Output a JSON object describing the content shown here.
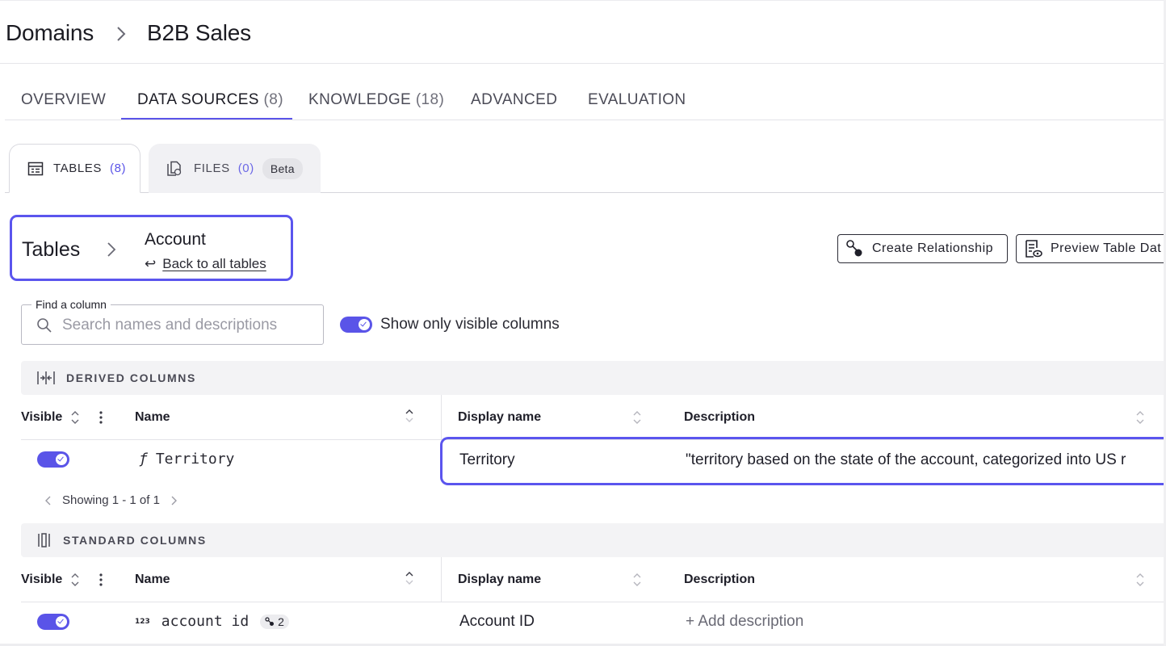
{
  "breadcrumb": {
    "root": "Domains",
    "current": "B2B Sales"
  },
  "main_tabs": [
    {
      "label": "OVERVIEW",
      "count": ""
    },
    {
      "label": "DATA SOURCES",
      "count": "(8)"
    },
    {
      "label": "KNOWLEDGE",
      "count": "(18)"
    },
    {
      "label": "ADVANCED",
      "count": ""
    },
    {
      "label": "EVALUATION",
      "count": ""
    }
  ],
  "sub_tabs": {
    "tables": {
      "label": "TABLES",
      "count": "(8)"
    },
    "files": {
      "label": "FILES",
      "count": "(0)",
      "badge": "Beta"
    }
  },
  "tables_crumb": {
    "root": "Tables",
    "current": "Account",
    "back_arrow": "↩",
    "back_label": "Back to all tables"
  },
  "actions": {
    "create_relationship": "Create Relationship",
    "preview": "Preview Table Dat"
  },
  "search": {
    "label": "Find a column",
    "placeholder": "Search names and descriptions"
  },
  "visible_filter": {
    "label": "Show only visible columns",
    "on": true
  },
  "derived": {
    "title": "DERIVED COLUMNS",
    "headers": {
      "visible": "Visible",
      "name": "Name",
      "display": "Display name",
      "description": "Description"
    },
    "rows": [
      {
        "visible": true,
        "type_icon": "ƒ",
        "name": "Territory",
        "display": "Territory",
        "description": "\"territory based on the state of the account, categorized into US r"
      }
    ],
    "pager": "Showing 1 - 1 of 1"
  },
  "standard": {
    "title": "STANDARD COLUMNS",
    "headers": {
      "visible": "Visible",
      "name": "Name",
      "display": "Display name",
      "description": "Description"
    },
    "rows": [
      {
        "visible": true,
        "type_icon": "123",
        "name": "account id",
        "relations": "2",
        "display": "Account ID",
        "description": "+ Add description"
      }
    ]
  },
  "colors": {
    "accent": "#5a54e8",
    "highlight": "#5b55ee"
  }
}
